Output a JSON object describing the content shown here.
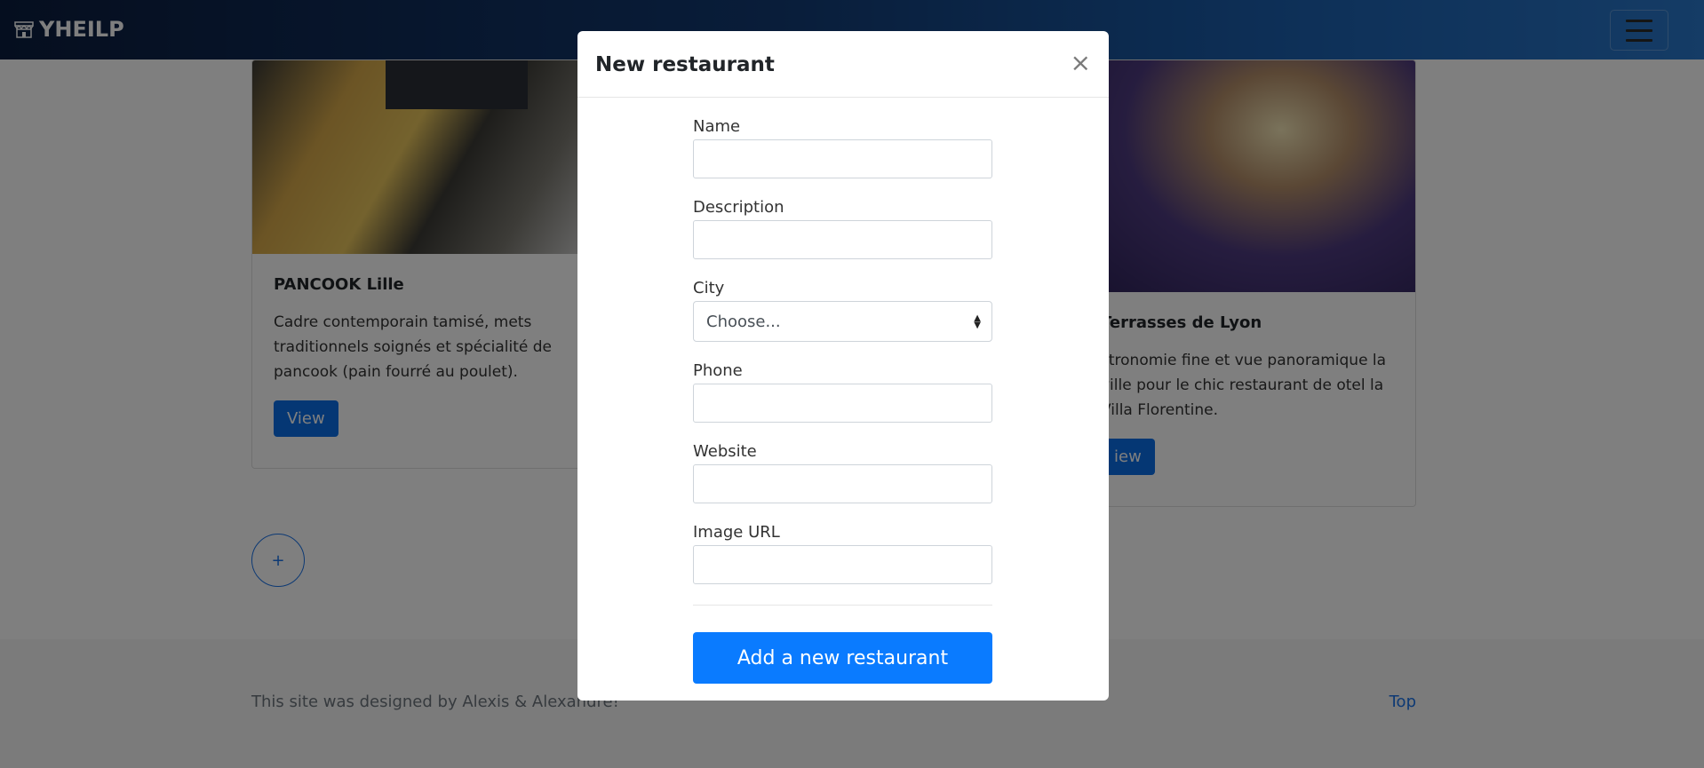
{
  "navbar": {
    "brand": "YHEILP",
    "brand_icon": "store-icon",
    "toggler_icon": "hamburger-icon"
  },
  "restaurants": [
    {
      "title": "PANCOOK Lille",
      "description": "Cadre contemporain tamisé, mets traditionnels soignés et spécialité de pancook (pain fourré au poulet).",
      "view_label": "View"
    },
    {
      "title": "Terrasses de Lyon",
      "description": "stronomie fine et vue panoramique la ville pour le chic restaurant de otel la Villa Florentine.",
      "view_label": "iew"
    }
  ],
  "add_button": "+",
  "footer": {
    "credit": "This site was designed by Alexis & Alexandre!",
    "top_link": "Top"
  },
  "modal": {
    "title": "New restaurant",
    "close_glyph": "×",
    "fields": {
      "name_label": "Name",
      "description_label": "Description",
      "city_label": "City",
      "city_selected": "Choose...",
      "phone_label": "Phone",
      "website_label": "Website",
      "image_label": "Image URL"
    },
    "submit_label": "Add a new restaurant"
  },
  "colors": {
    "accent": "#0a7bff",
    "navbar_dark": "#0b1d3e",
    "navbar_light": "#2a78cc"
  }
}
